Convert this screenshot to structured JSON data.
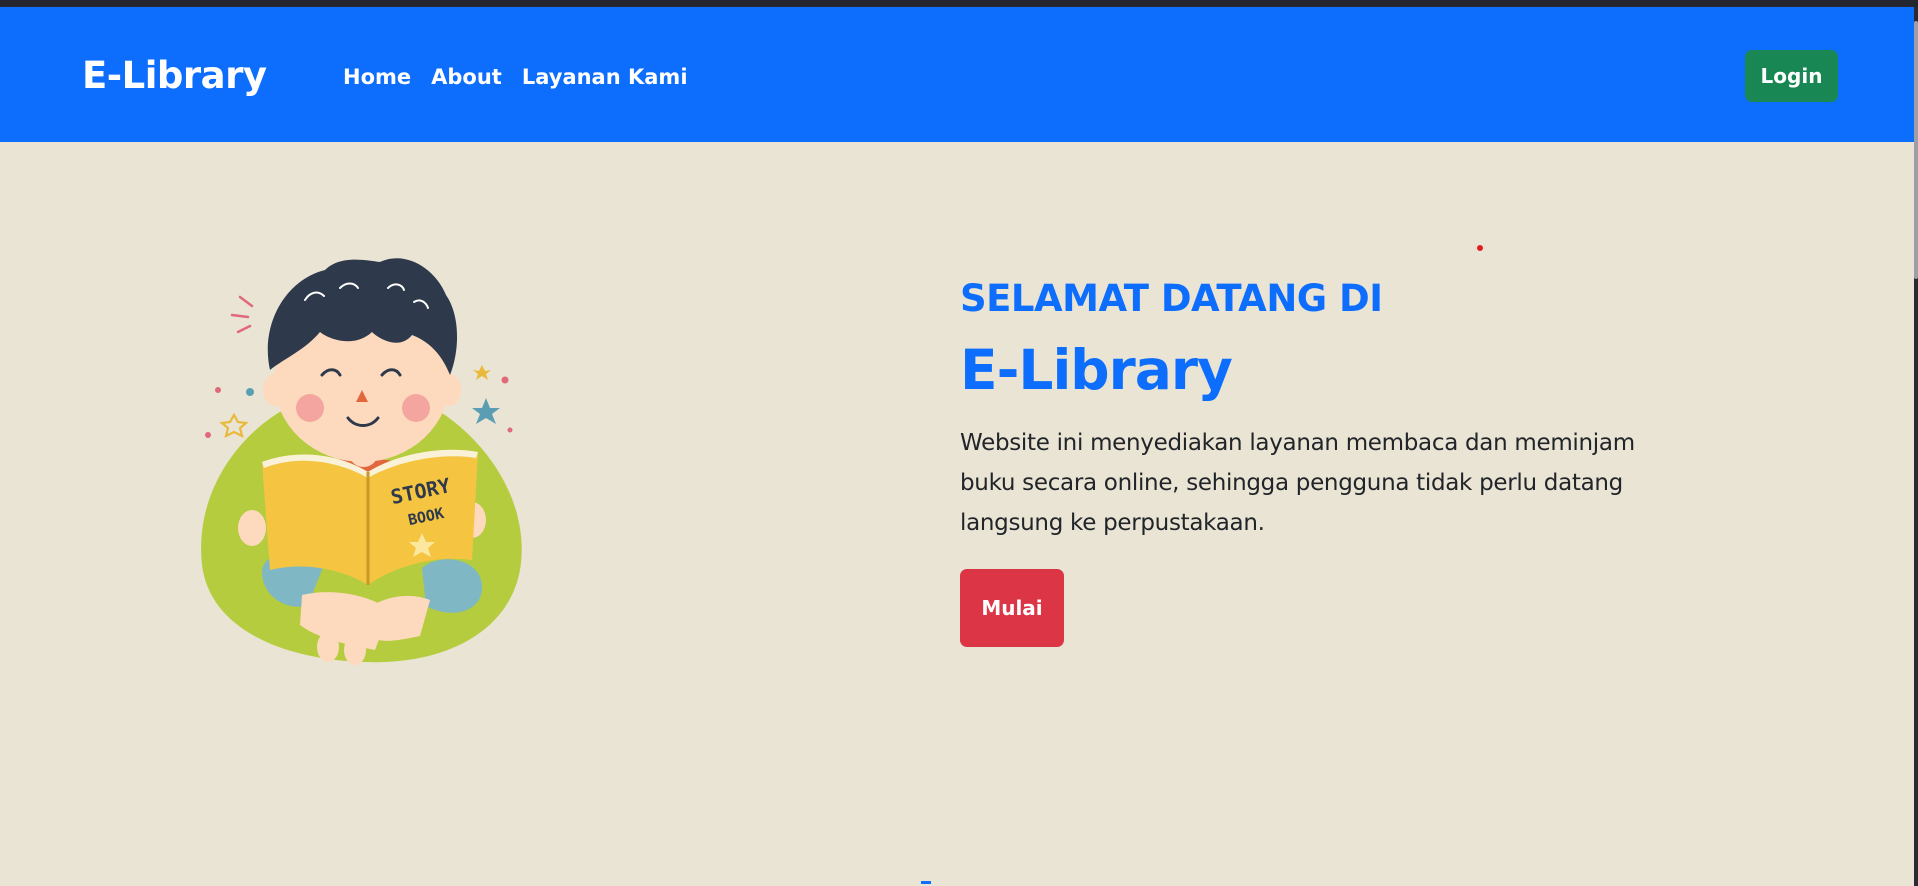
{
  "navbar": {
    "brand": "E-Library",
    "links": [
      "Home",
      "About",
      "Layanan Kami"
    ],
    "login_label": "Login"
  },
  "hero": {
    "greeting": "SELAMAT DATANG DI",
    "title": "E-Library",
    "description": "Website ini menyediakan layanan membaca dan meminjam buku secara online, sehingga pengguna tidak perlu datang langsung ke perpustakaan.",
    "button_label": "Mulai",
    "illustration_book_text": [
      "STORY",
      "BOOK"
    ]
  },
  "colors": {
    "navbar": "#0D6EFD",
    "background": "#EAE4D5",
    "primary_text": "#0D6EFD",
    "login_button": "#198754",
    "start_button": "#DC3545"
  }
}
